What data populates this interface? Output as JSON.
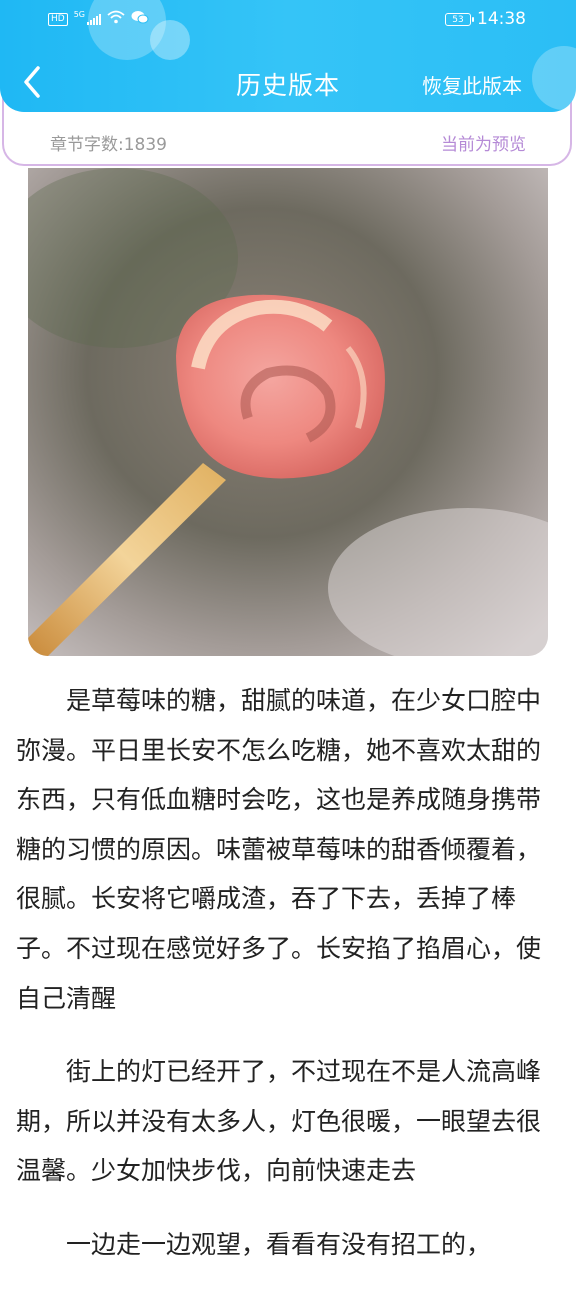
{
  "status_bar": {
    "network_label": "HD",
    "signal_label": "5G",
    "battery": "53",
    "time": "14:38"
  },
  "nav": {
    "title": "历史版本",
    "restore_label": "恢复此版本"
  },
  "info": {
    "word_count": "章节字数:1839",
    "preview_label": "当前为预览"
  },
  "colors": {
    "header": "#2bbef5",
    "preview_text": "#b58ad6",
    "card_border": "#d6b6e6"
  },
  "article": {
    "paragraphs": [
      "是草莓味的糖，甜腻的味道，在少女口腔中弥漫。平日里长安不怎么吃糖，她不喜欢太甜的东西，只有低血糖时会吃，这也是养成随身携带糖的习惯的原因。味蕾被草莓味的甜香倾覆着，很腻。长安将它嚼成渣，吞了下去，丢掉了棒子。不过现在感觉好多了。长安掐了掐眉心，使自己清醒",
      "街上的灯已经开了，不过现在不是人流高峰期，所以并没有太多人，灯色很暖，一眼望去很温馨。少女加快步伐，向前快速走去",
      "一边走一边观望，看看有没有招工的，"
    ]
  }
}
